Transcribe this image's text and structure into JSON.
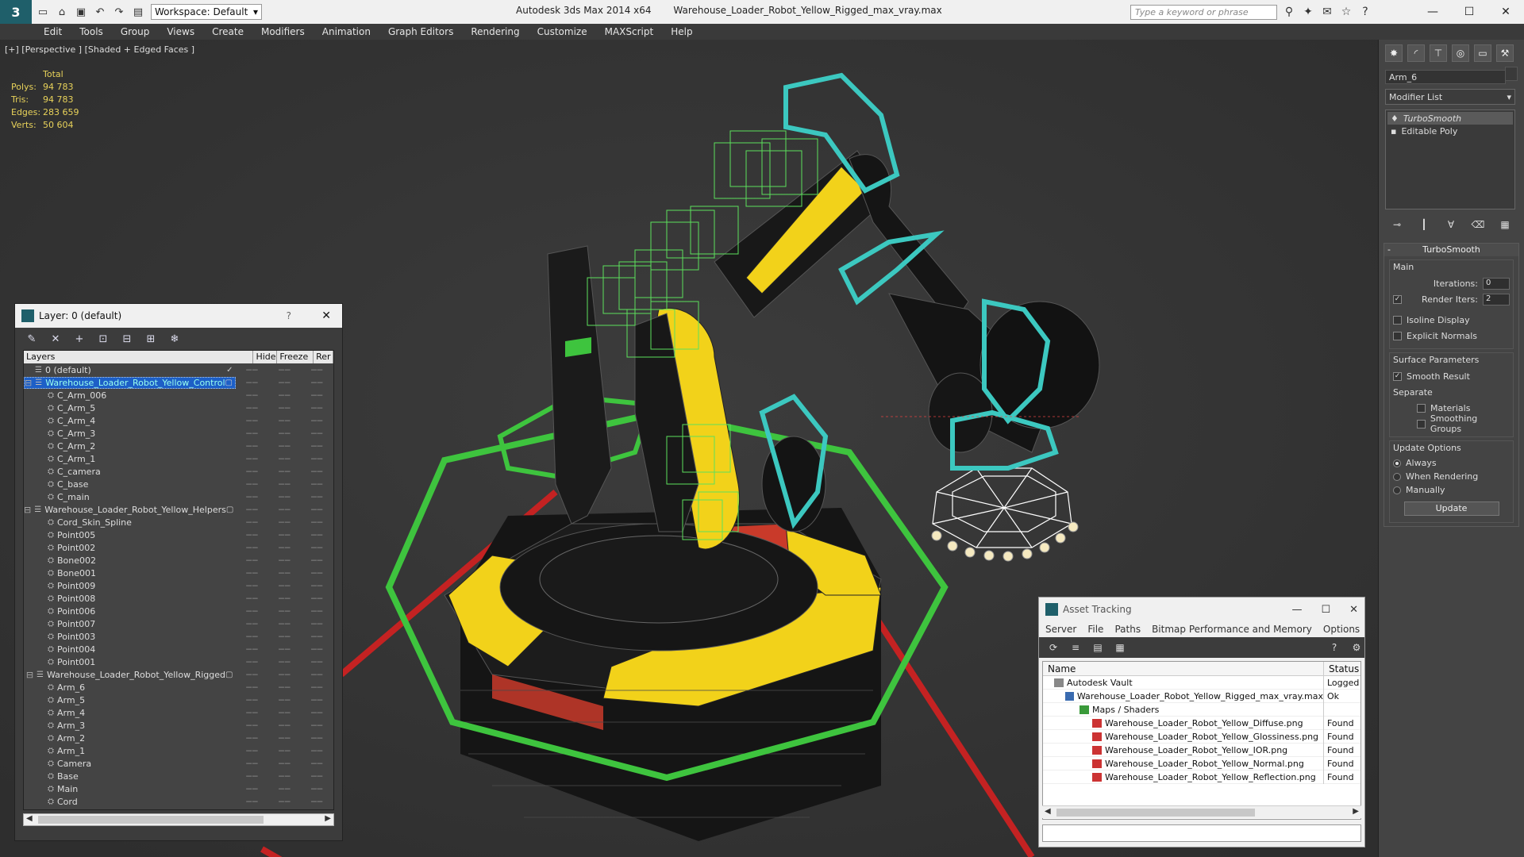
{
  "app": {
    "title": "Autodesk 3ds Max  2014 x64",
    "file": "Warehouse_Loader_Robot_Yellow_Rigged_max_vray.max",
    "workspace": "Workspace: Default",
    "search_placeholder": "Type a keyword or phrase"
  },
  "menu": [
    "Edit",
    "Tools",
    "Group",
    "Views",
    "Create",
    "Modifiers",
    "Animation",
    "Graph Editors",
    "Rendering",
    "Customize",
    "MAXScript",
    "Help"
  ],
  "viewport": {
    "label": "[+] [Perspective ] [Shaded + Edged Faces ]",
    "stats": {
      "header": "Total",
      "rows": [
        {
          "label": "Polys:",
          "value": "94 783"
        },
        {
          "label": "Tris:",
          "value": "94 783"
        },
        {
          "label": "Edges:",
          "value": "283 659"
        },
        {
          "label": "Verts:",
          "value": "50 604"
        }
      ]
    }
  },
  "command_panel": {
    "object_name": "Arm_6",
    "modifier_list": "Modifier List",
    "stack": [
      "TurboSmooth",
      "Editable Poly"
    ],
    "rollout_title": "TurboSmooth",
    "main_group": "Main",
    "iterations_label": "Iterations:",
    "iterations_value": "0",
    "render_iters_label": "Render Iters:",
    "render_iters_value": "2",
    "isoline": "Isoline Display",
    "explicit": "Explicit Normals",
    "surface_group": "Surface Parameters",
    "smooth_result": "Smooth Result",
    "separate": "Separate",
    "materials": "Materials",
    "smoothing_groups": "Smoothing Groups",
    "update_group": "Update Options",
    "always": "Always",
    "when_rendering": "When Rendering",
    "manually": "Manually",
    "update_button": "Update"
  },
  "layer_window": {
    "title": "Layer: 0 (default)",
    "help": "?",
    "columns": [
      "Layers",
      "Hide",
      "Freeze",
      "Rer"
    ],
    "rows": [
      {
        "name": "0 (default)",
        "level": 0,
        "type": "layer"
      },
      {
        "name": "Warehouse_Loader_Robot_Yellow_Control",
        "level": 0,
        "type": "layer-group",
        "selected": true
      },
      {
        "name": "C_Arm_006",
        "level": 1,
        "type": "obj"
      },
      {
        "name": "C_Arm_5",
        "level": 1,
        "type": "obj"
      },
      {
        "name": "C_Arm_4",
        "level": 1,
        "type": "obj"
      },
      {
        "name": "C_Arm_3",
        "level": 1,
        "type": "obj"
      },
      {
        "name": "C_Arm_2",
        "level": 1,
        "type": "obj"
      },
      {
        "name": "C_Arm_1",
        "level": 1,
        "type": "obj"
      },
      {
        "name": "C_camera",
        "level": 1,
        "type": "obj"
      },
      {
        "name": "C_base",
        "level": 1,
        "type": "obj"
      },
      {
        "name": "C_main",
        "level": 1,
        "type": "obj"
      },
      {
        "name": "Warehouse_Loader_Robot_Yellow_Helpers",
        "level": 0,
        "type": "layer-group"
      },
      {
        "name": "Cord_Skin_Spline",
        "level": 1,
        "type": "obj"
      },
      {
        "name": "Point005",
        "level": 1,
        "type": "obj"
      },
      {
        "name": "Point002",
        "level": 1,
        "type": "obj"
      },
      {
        "name": "Bone002",
        "level": 1,
        "type": "obj"
      },
      {
        "name": "Bone001",
        "level": 1,
        "type": "obj"
      },
      {
        "name": "Point009",
        "level": 1,
        "type": "obj"
      },
      {
        "name": "Point008",
        "level": 1,
        "type": "obj"
      },
      {
        "name": "Point006",
        "level": 1,
        "type": "obj"
      },
      {
        "name": "Point007",
        "level": 1,
        "type": "obj"
      },
      {
        "name": "Point003",
        "level": 1,
        "type": "obj"
      },
      {
        "name": "Point004",
        "level": 1,
        "type": "obj"
      },
      {
        "name": "Point001",
        "level": 1,
        "type": "obj"
      },
      {
        "name": "Warehouse_Loader_Robot_Yellow_Rigged",
        "level": 0,
        "type": "layer-group"
      },
      {
        "name": "Arm_6",
        "level": 1,
        "type": "obj"
      },
      {
        "name": "Arm_5",
        "level": 1,
        "type": "obj"
      },
      {
        "name": "Arm_4",
        "level": 1,
        "type": "obj"
      },
      {
        "name": "Arm_3",
        "level": 1,
        "type": "obj"
      },
      {
        "name": "Arm_2",
        "level": 1,
        "type": "obj"
      },
      {
        "name": "Arm_1",
        "level": 1,
        "type": "obj"
      },
      {
        "name": "Camera",
        "level": 1,
        "type": "obj"
      },
      {
        "name": "Base",
        "level": 1,
        "type": "obj"
      },
      {
        "name": "Main",
        "level": 1,
        "type": "obj"
      },
      {
        "name": "Cord",
        "level": 1,
        "type": "obj"
      }
    ]
  },
  "asset_window": {
    "title": "Asset Tracking",
    "menu": [
      "Server",
      "File",
      "Paths",
      "Bitmap Performance and Memory",
      "Options"
    ],
    "columns": [
      "Name",
      "Status"
    ],
    "rows": [
      {
        "name": "Autodesk Vault",
        "status": "Logged",
        "level": 0,
        "icon": "vault"
      },
      {
        "name": "Warehouse_Loader_Robot_Yellow_Rigged_max_vray.max",
        "status": "Ok",
        "level": 1,
        "icon": "max"
      },
      {
        "name": "Maps / Shaders",
        "status": "",
        "level": 2,
        "icon": "maps"
      },
      {
        "name": "Warehouse_Loader_Robot_Yellow_Diffuse.png",
        "status": "Found",
        "level": 3,
        "icon": "png"
      },
      {
        "name": "Warehouse_Loader_Robot_Yellow_Glossiness.png",
        "status": "Found",
        "level": 3,
        "icon": "png"
      },
      {
        "name": "Warehouse_Loader_Robot_Yellow_IOR.png",
        "status": "Found",
        "level": 3,
        "icon": "png"
      },
      {
        "name": "Warehouse_Loader_Robot_Yellow_Normal.png",
        "status": "Found",
        "level": 3,
        "icon": "png"
      },
      {
        "name": "Warehouse_Loader_Robot_Yellow_Reflection.png",
        "status": "Found",
        "level": 3,
        "icon": "png"
      }
    ]
  },
  "colors": {
    "stats": "#e8d25a",
    "robot_yellow": "#f2d21a",
    "helper_green": "#3ec43e",
    "helper_cyan": "#3cc8c0",
    "selection_blue": "#1d5fc7"
  }
}
